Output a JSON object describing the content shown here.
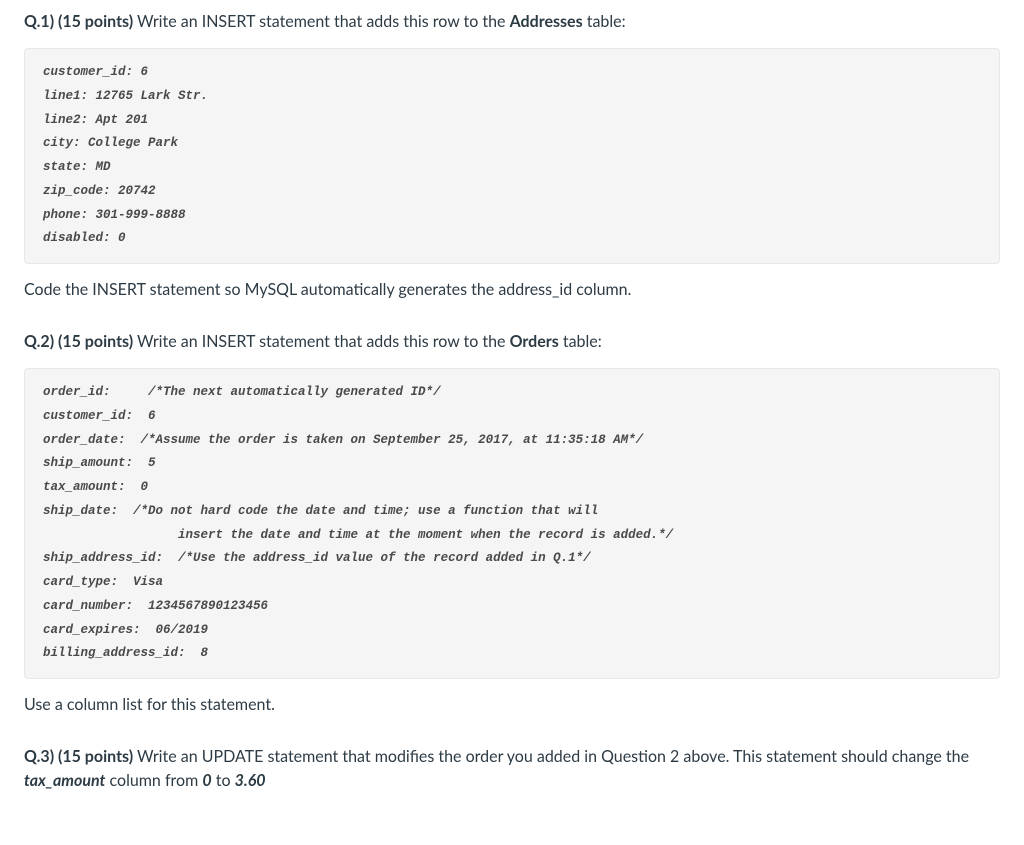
{
  "q1": {
    "label": "Q.1) (15 points)",
    "prompt_a": " Write an INSERT statement that adds this row to the ",
    "table": "Addresses",
    "prompt_b": " table:",
    "code": "customer_id: 6\nline1: 12765 Lark Str.\nline2: Apt 201\ncity: College Park\nstate: MD\nzip_code: 20742\nphone: 301-999-8888\ndisabled: 0",
    "note": "Code the INSERT statement so MySQL automatically generates the address_id column."
  },
  "q2": {
    "label": "Q.2) (15 points)",
    "prompt_a": " Write an INSERT statement that adds this row to the ",
    "table": "Orders",
    "prompt_b": " table:",
    "code": "order_id:     /*The next automatically generated ID*/\ncustomer_id:  6\norder_date:  /*Assume the order is taken on September 25, 2017, at 11:35:18 AM*/\nship_amount:  5\ntax_amount:  0\nship_date:  /*Do not hard code the date and time; use a function that will\n                  insert the date and time at the moment when the record is added.*/\nship_address_id:  /*Use the address_id value of the record added in Q.1*/\ncard_type:  Visa\ncard_number:  1234567890123456\ncard_expires:  06/2019\nbilling_address_id:  8",
    "note": "Use a column list for this statement."
  },
  "q3": {
    "label": "Q.3) (15 points)",
    "prompt_a": " Write an UPDATE statement that modifies the order you added in Question 2 above. This statement should change the ",
    "col": "tax_amount",
    "prompt_b": " column from ",
    "from": "0",
    "prompt_c": " to ",
    "to": "3.60"
  }
}
